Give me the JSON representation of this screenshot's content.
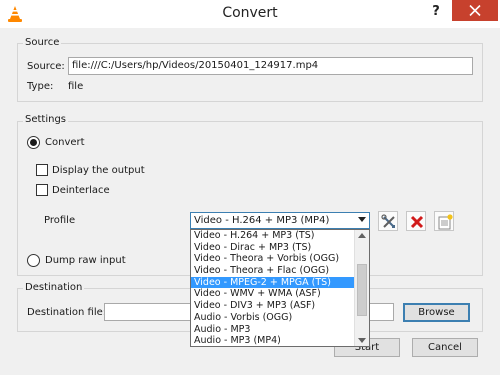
{
  "window": {
    "title": "Convert",
    "help_label": "?",
    "icons": {
      "app": "vlc-cone-icon",
      "close": "close-icon"
    }
  },
  "source": {
    "group_label": "Source",
    "source_label": "Source:",
    "source_value": "file:///C:/Users/hp/Videos/20150401_124917.mp4",
    "type_label": "Type:",
    "type_value": "file"
  },
  "settings": {
    "group_label": "Settings",
    "convert_label": "Convert",
    "display_output_label": "Display the output",
    "deinterlace_label": "Deinterlace",
    "profile_label": "Profile",
    "profile_selected": "Video - H.264 + MP3 (MP4)",
    "dump_raw_label": "Dump raw input",
    "profile_options": [
      "Video - H.264 + MP3 (TS)",
      "Video - Dirac + MP3 (TS)",
      "Video - Theora + Vorbis (OGG)",
      "Video - Theora + Flac (OGG)",
      "Video - MPEG-2 + MPGA (TS)",
      "Video - WMV + WMA (ASF)",
      "Video - DIV3 + MP3 (ASF)",
      "Audio - Vorbis (OGG)",
      "Audio - MP3",
      "Audio - MP3 (MP4)"
    ],
    "highlighted_index": 4,
    "tool_icons": {
      "edit": "wrench-screwdriver-icon",
      "delete": "red-x-delete-icon",
      "new": "new-profile-icon"
    }
  },
  "destination": {
    "group_label": "Destination",
    "file_label": "Destination file:",
    "file_value": "",
    "browse_label": "Browse"
  },
  "footer": {
    "start_label": "Start",
    "cancel_label": "Cancel"
  },
  "colors": {
    "close_button": "#c7412d",
    "selection": "#3399ff",
    "vlc_orange": "#ff8800"
  }
}
